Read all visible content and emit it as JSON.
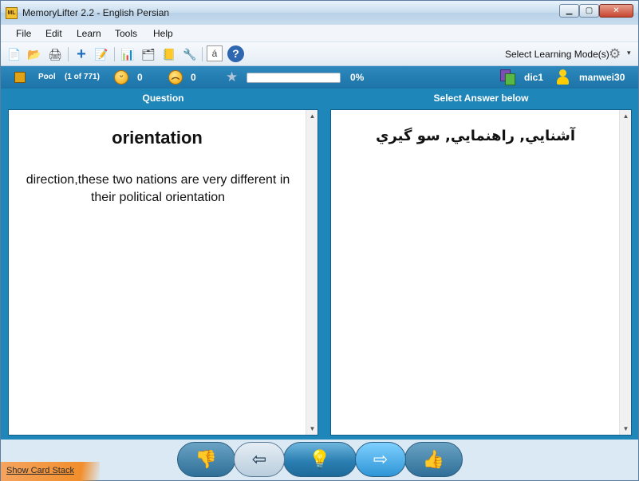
{
  "window": {
    "title": "MemoryLifter 2.2 - English Persian",
    "app_icon_text": "ML",
    "min_glyph": "▁",
    "max_glyph": "▢",
    "close_glyph": "✕"
  },
  "menu": [
    "File",
    "Edit",
    "Learn",
    "Tools",
    "Help"
  ],
  "toolbar": {
    "learning_mode_label": "Select Learning Mode(s)",
    "caret": "▾",
    "icons": {
      "new": "📄",
      "open": "📂",
      "print": "🖨",
      "add": "+",
      "edit": "📝",
      "present": "📊",
      "print_cards": "🗂",
      "book": "📒",
      "settings": "🔧",
      "charset": "á",
      "help": "?"
    }
  },
  "status": {
    "pool_label": "Pool",
    "pool_count": "(1 of 771)",
    "correct_count": "0",
    "wrong_count": "0",
    "progress_percent_text": "0%",
    "progress_value": 0.0,
    "dictionary_name": "dic1",
    "user_name": "manwei30"
  },
  "question": {
    "header": "Question",
    "word": "orientation",
    "example": "direction,these two nations are very different in their political orientation"
  },
  "answer": {
    "header": "Select Answer below",
    "text": "آشنايي, راهنمايي, سو گيري"
  },
  "nav": {
    "wrong_icon": "👎",
    "prev_icon": "⇦",
    "hint_icon": "💡",
    "next_icon": "⇨",
    "right_icon": "👍"
  },
  "show_card_stack": "Show Card Stack",
  "colors": {
    "accent": "#1f86b9",
    "progress": "#4caf50"
  }
}
